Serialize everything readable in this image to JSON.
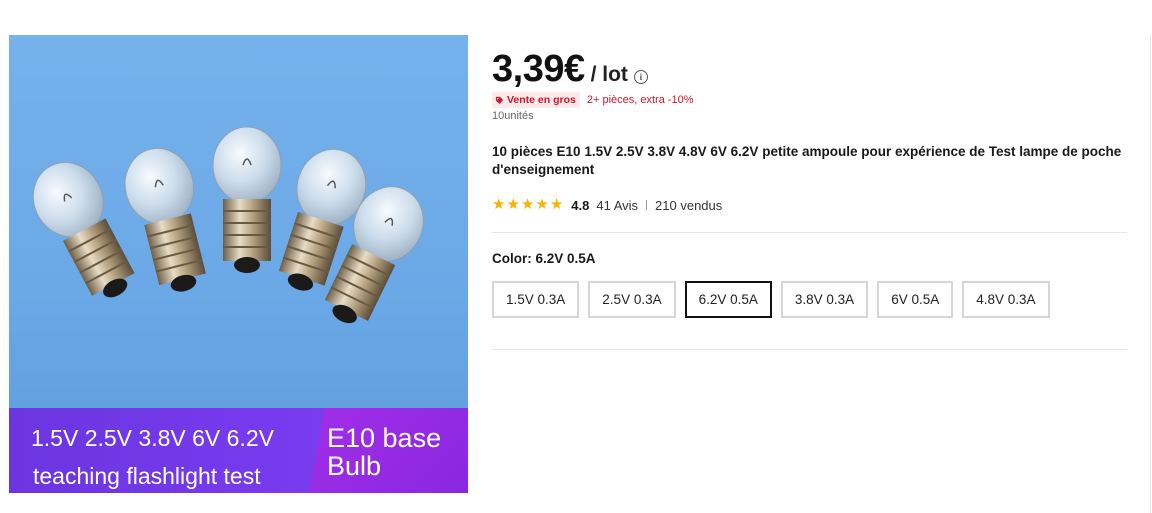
{
  "image": {
    "banner_line1": "1.5V 2.5V 3.8V 6V 6.2V",
    "banner_line2": "teaching flashlight test",
    "badge_line1": "E10 base",
    "badge_line2": "Bulb"
  },
  "price": {
    "amount": "3,39€",
    "unit": "/ lot",
    "info_glyph": "i"
  },
  "wholesale": {
    "tag_label": "Vente en gros",
    "discount": "2+ pièces, extra -10%"
  },
  "units": "10unités",
  "title": "10 pièces E10 1.5V 2.5V 3.8V 4.8V 6V 6.2V petite ampoule pour expérience de Test lampe de poche d'enseignement",
  "rating": {
    "stars": 5,
    "value": "4.8",
    "reviews": "41 Avis",
    "sold": "210 vendus"
  },
  "color": {
    "label": "Color: 6.2V 0.5A",
    "selected": "6.2V 0.5A",
    "options": [
      "1.5V 0.3A",
      "2.5V 0.3A",
      "6.2V 0.5A",
      "3.8V 0.3A",
      "6V 0.5A",
      "4.8V 0.3A"
    ]
  },
  "colors": {
    "star": "#f5b400",
    "sale_red": "#d0152c",
    "banner_purple": "#7a3cf0",
    "image_blue": "#6aa7e6"
  }
}
